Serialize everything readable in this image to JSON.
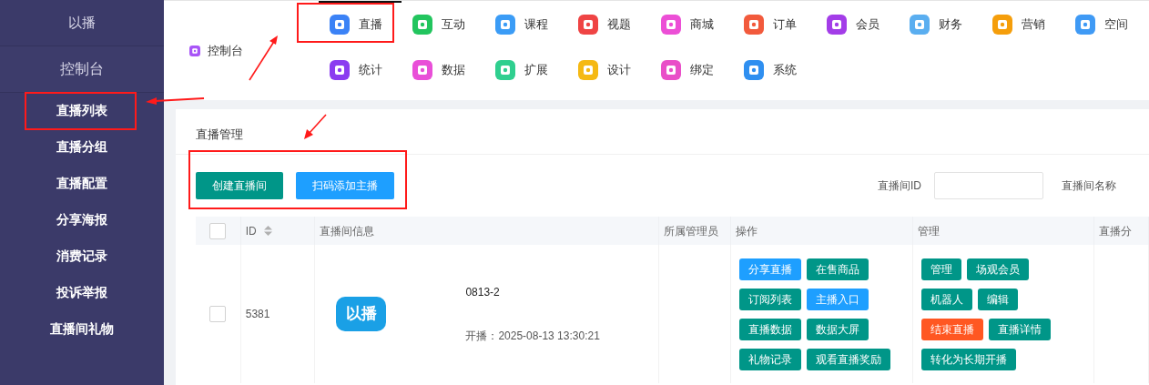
{
  "sidebar": {
    "brand": "以播",
    "section": "控制台",
    "items": [
      {
        "label": "直播列表"
      },
      {
        "label": "直播分组"
      },
      {
        "label": "直播配置"
      },
      {
        "label": "分享海报"
      },
      {
        "label": "消费记录"
      },
      {
        "label": "投诉举报"
      },
      {
        "label": "直播间礼物"
      }
    ]
  },
  "top_nav": {
    "home": {
      "label": "控制台",
      "color": "#a855f7"
    },
    "items": [
      {
        "label": "直播",
        "color": "#3b82f6",
        "selected": true
      },
      {
        "label": "互动",
        "color": "#22c55e",
        "selected": false
      },
      {
        "label": "课程",
        "color": "#3b9cf6",
        "selected": false
      },
      {
        "label": "视题",
        "color": "#ef4444",
        "selected": false
      },
      {
        "label": "商城",
        "color": "#ec4fd6",
        "selected": false
      },
      {
        "label": "订单",
        "color": "#f25a3c",
        "selected": false
      },
      {
        "label": "会员",
        "color": "#a33de8",
        "selected": false
      },
      {
        "label": "财务",
        "color": "#5aaef0",
        "selected": false
      },
      {
        "label": "营销",
        "color": "#f59e0b",
        "selected": false
      },
      {
        "label": "空间",
        "color": "#3f9af5",
        "selected": false
      },
      {
        "label": "统计",
        "color": "#8b3cf0",
        "selected": false
      },
      {
        "label": "数据",
        "color": "#e94fd8",
        "selected": false
      },
      {
        "label": "扩展",
        "color": "#2fcf8f",
        "selected": false
      },
      {
        "label": "设计",
        "color": "#f5b914",
        "selected": false
      },
      {
        "label": "绑定",
        "color": "#e94fc8",
        "selected": false
      },
      {
        "label": "系统",
        "color": "#2f8ff0",
        "selected": false
      }
    ]
  },
  "panel": {
    "title": "直播管理",
    "buttons": [
      {
        "label": "创建直播间",
        "color": "#009688"
      },
      {
        "label": "扫码添加主播",
        "color": "#1e9fff"
      }
    ],
    "filters": [
      {
        "label": "直播间ID"
      },
      {
        "label": "直播间名称"
      }
    ]
  },
  "table": {
    "select_all_checked": false,
    "columns": [
      "ID",
      "直播间信息",
      "所属管理员",
      "操作",
      "管理",
      "直播分"
    ],
    "rows": [
      {
        "checked": false,
        "id": "5381",
        "logo": "以播",
        "name": "0813-2",
        "start": "开播：2025-08-13 13:30:21",
        "actions": [
          {
            "label": "分享直播",
            "color": "#1e9fff"
          },
          {
            "label": "在售商品",
            "color": "#009688"
          },
          {
            "label": "订阅列表",
            "color": "#009688"
          },
          {
            "label": "主播入口",
            "color": "#1e9fff"
          },
          {
            "label": "直播数据",
            "color": "#009688"
          },
          {
            "label": "数据大屏",
            "color": "#009688"
          },
          {
            "label": "礼物记录",
            "color": "#009688"
          },
          {
            "label": "观看直播奖励",
            "color": "#009688"
          }
        ],
        "manage": [
          {
            "label": "管理",
            "color": "#009688"
          },
          {
            "label": "场观会员",
            "color": "#009688"
          },
          {
            "label": "机器人",
            "color": "#009688"
          },
          {
            "label": "编辑",
            "color": "#009688"
          },
          {
            "label": "结束直播",
            "color": "#ff5722"
          },
          {
            "label": "直播详情",
            "color": "#009688"
          },
          {
            "label": "转化为长期开播",
            "color": "#009688"
          }
        ]
      }
    ]
  }
}
